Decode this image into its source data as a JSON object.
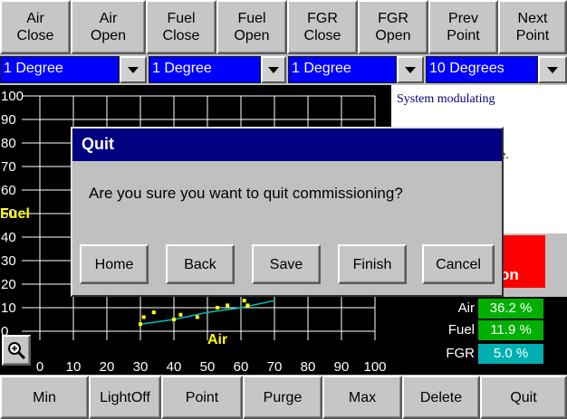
{
  "toolbar": {
    "buttons": [
      {
        "line1": "Air",
        "line2": "Close"
      },
      {
        "line1": "Air",
        "line2": "Open"
      },
      {
        "line1": "Fuel",
        "line2": "Close"
      },
      {
        "line1": "Fuel",
        "line2": "Open"
      },
      {
        "line1": "FGR",
        "line2": "Close"
      },
      {
        "line1": "FGR",
        "line2": "Open"
      },
      {
        "line1": "Prev",
        "line2": "Point"
      },
      {
        "line1": "Next",
        "line2": "Point"
      }
    ]
  },
  "step_selects": [
    {
      "value": "1 Degree"
    },
    {
      "value": "1 Degree"
    },
    {
      "value": "1 Degree"
    },
    {
      "value": "10 Degrees"
    }
  ],
  "chart_data": {
    "type": "scatter",
    "xlabel": "Air",
    "ylabel": "Fuel",
    "xlim": [
      0,
      100
    ],
    "ylim": [
      0,
      100
    ],
    "x_ticks": [
      "0",
      "10",
      "20",
      "30",
      "40",
      "50",
      "60",
      "70",
      "80",
      "90",
      "100"
    ],
    "y_ticks": [
      "0",
      "10",
      "20",
      "30",
      "40",
      "50",
      "60",
      "70",
      "80",
      "90",
      "100"
    ],
    "grid": true,
    "series": [
      {
        "color": "#ffff00",
        "points": [
          [
            30,
            3
          ],
          [
            31,
            6
          ],
          [
            34,
            8
          ],
          [
            40,
            5
          ],
          [
            42,
            7
          ],
          [
            47,
            6
          ],
          [
            53,
            10
          ],
          [
            56,
            11
          ],
          [
            61,
            13
          ],
          [
            62,
            11
          ]
        ]
      }
    ],
    "curve": {
      "color": "#00c0c0",
      "points": [
        [
          30,
          3
        ],
        [
          40,
          5
        ],
        [
          50,
          8
        ],
        [
          60,
          10
        ],
        [
          70,
          13
        ]
      ]
    }
  },
  "status": {
    "message": "System modulating",
    "message2_tail": "e.",
    "badge_tail": "on",
    "badge_color": "#ff0000"
  },
  "readouts": [
    {
      "label": "Air",
      "value": "36.2 %",
      "color": "#00b000"
    },
    {
      "label": "Fuel",
      "value": "11.9 %",
      "color": "#00b000"
    },
    {
      "label": "FGR",
      "value": "5.0 %",
      "color": "#00b0b0"
    }
  ],
  "zoom": {
    "icon": "zoom-in-icon"
  },
  "bottom_bar": {
    "buttons": [
      "Min",
      "LightOff",
      "Point",
      "Purge",
      "Max",
      "Delete",
      "Quit"
    ]
  },
  "dialog": {
    "title": "Quit",
    "message": "Are you sure you want to quit commissioning?",
    "buttons": [
      "Home",
      "Back",
      "Save",
      "Finish",
      "Cancel"
    ],
    "title_color": "#000080"
  }
}
